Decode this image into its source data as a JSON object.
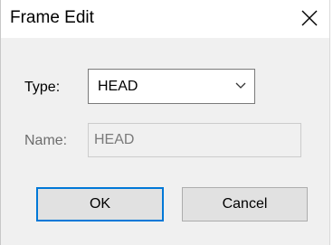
{
  "window": {
    "title": "Frame Edit",
    "close_icon": "close-icon"
  },
  "form": {
    "type_label": "Type:",
    "type_value": "HEAD",
    "type_icon": "chevron-down-icon",
    "name_label": "Name:",
    "name_value": "HEAD"
  },
  "buttons": {
    "ok_label": "OK",
    "cancel_label": "Cancel"
  },
  "colors": {
    "dialog_bg": "#f0f0f0",
    "titlebar_bg": "#ffffff",
    "focus_accent": "#0078d7",
    "disabled_text": "#7a7a7a"
  }
}
